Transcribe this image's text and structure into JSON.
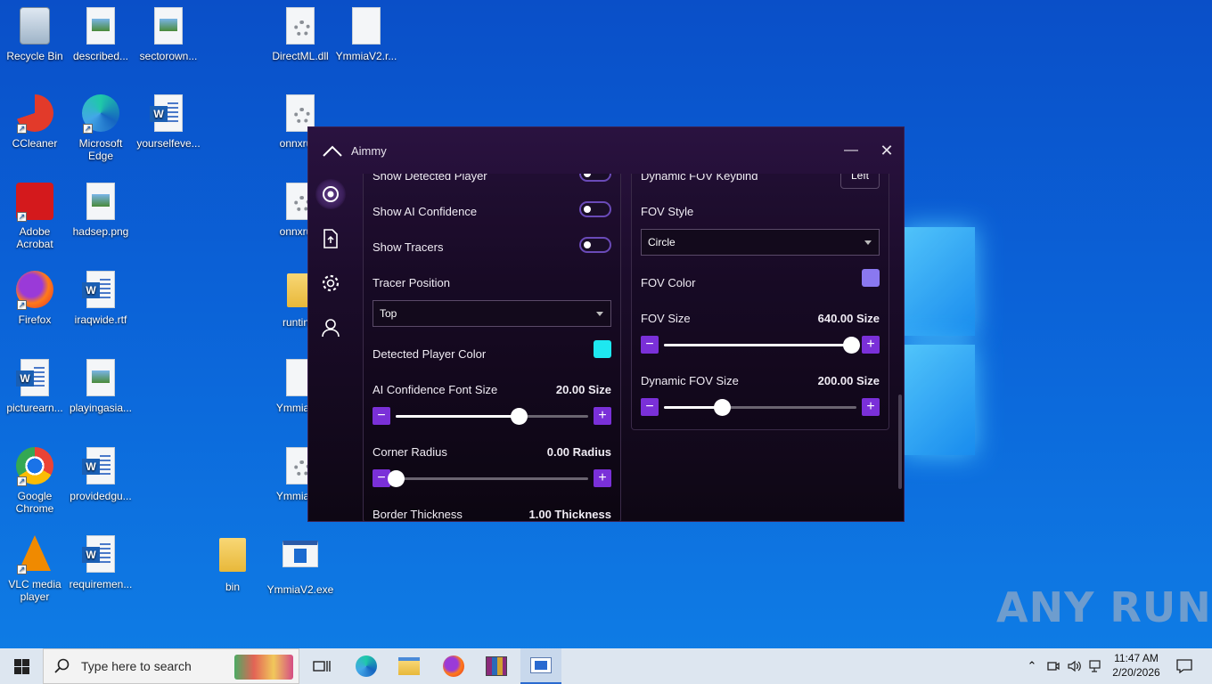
{
  "desktop": {
    "icons": [
      {
        "label": "Recycle Bin",
        "icon": "recycle-bin-icon"
      },
      {
        "label": "described...",
        "icon": "image-file-icon"
      },
      {
        "label": "sectorown...",
        "icon": "image-file-icon"
      },
      {
        "label": "DirectML.dll",
        "icon": "dll-file-icon"
      },
      {
        "label": "YmmiaV2.r...",
        "icon": "blank-file-icon"
      },
      {
        "label": "CCleaner",
        "icon": "ccleaner-icon"
      },
      {
        "label": "Microsoft Edge",
        "icon": "edge-icon"
      },
      {
        "label": "yourselfeve...",
        "icon": "word-doc-icon"
      },
      {
        "label": "onnxru...",
        "icon": "dll-file-icon"
      },
      {
        "label": "Adobe Acrobat",
        "icon": "acrobat-icon"
      },
      {
        "label": "hadsep.png",
        "icon": "image-file-icon"
      },
      {
        "label": "onnxru...",
        "icon": "dll-file-icon"
      },
      {
        "label": "Firefox",
        "icon": "firefox-icon"
      },
      {
        "label": "iraqwide.rtf",
        "icon": "word-doc-icon"
      },
      {
        "label": "runtin...",
        "icon": "folder-icon"
      },
      {
        "label": "picturearn...",
        "icon": "word-doc-icon"
      },
      {
        "label": "playingasia...",
        "icon": "image-file-icon"
      },
      {
        "label": "YmmiaV...",
        "icon": "blank-file-icon"
      },
      {
        "label": "Google Chrome",
        "icon": "chrome-icon"
      },
      {
        "label": "providedgu...",
        "icon": "word-doc-icon"
      },
      {
        "label": "YmmiaV...",
        "icon": "dll-file-icon"
      },
      {
        "label": "VLC media player",
        "icon": "vlc-icon"
      },
      {
        "label": "requiremen...",
        "icon": "word-doc-icon"
      },
      {
        "label": "bin",
        "icon": "folder-icon"
      },
      {
        "label": "YmmiaV2.exe",
        "icon": "exe-icon"
      }
    ]
  },
  "app": {
    "title": "Aimmy",
    "nav": [
      "aim-icon",
      "config-file-icon",
      "settings-gear-icon",
      "user-icon"
    ],
    "left": {
      "show_detected_player": "Show Detected Player",
      "show_ai_confidence": "Show AI Confidence",
      "show_tracers": "Show Tracers",
      "tracer_position_label": "Tracer Position",
      "tracer_position_value": "Top",
      "detected_player_color_label": "Detected Player Color",
      "detected_player_color": "#1ee8f0",
      "ai_conf_font_label": "AI Confidence Font Size",
      "ai_conf_font_value": "20.00 Size",
      "ai_conf_font_fraction": 0.64,
      "corner_radius_label": "Corner Radius",
      "corner_radius_value": "0.00 Radius",
      "corner_radius_fraction": 0.0,
      "border_thickness_label": "Border Thickness",
      "border_thickness_value": "1.00 Thickness"
    },
    "right": {
      "dynamic_fov_keybind_label": "Dynamic FOV Keybind",
      "dynamic_fov_keybind_value": "Left",
      "fov_style_label": "FOV Style",
      "fov_style_value": "Circle",
      "fov_color_label": "FOV Color",
      "fov_color": "#8a78f0",
      "fov_size_label": "FOV Size",
      "fov_size_value": "640.00 Size",
      "fov_size_fraction": 0.97,
      "dynamic_fov_size_label": "Dynamic FOV Size",
      "dynamic_fov_size_value": "200.00 Size",
      "dynamic_fov_size_fraction": 0.3
    }
  },
  "taskbar": {
    "search_placeholder": "Type here to search",
    "time": "11:47 AM",
    "date": "2/20/2026"
  },
  "watermark": "ANY RUN"
}
